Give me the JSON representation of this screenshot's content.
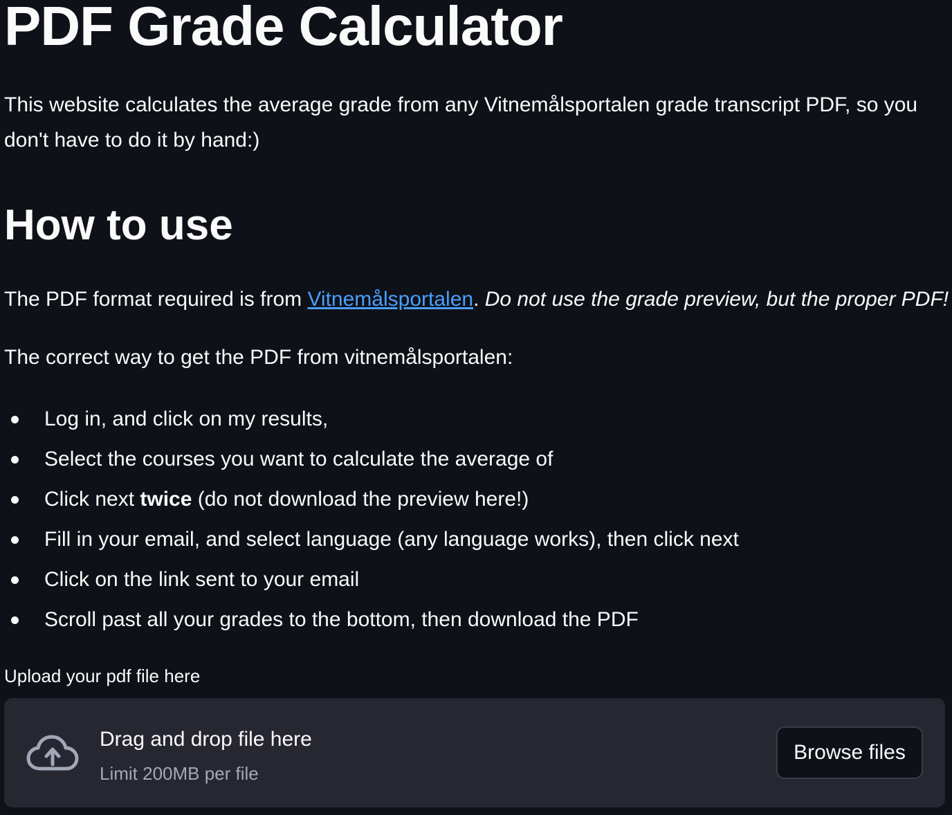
{
  "page": {
    "title": "PDF Grade Calculator",
    "intro": "This website calculates the average grade from any Vitnemålsportalen grade transcript PDF, so you don't have to do it by hand:)"
  },
  "how_to": {
    "heading": "How to use",
    "format_prefix": "The PDF format required is from ",
    "format_link": "Vitnemålsportalen",
    "format_period": ". ",
    "format_warning": "Do not use the grade preview, but the proper PDF!",
    "correct_way": "The correct way to get the PDF from vitnemålsportalen:",
    "steps": [
      {
        "text": "Log in, and click on my results,"
      },
      {
        "text": "Select the courses you want to calculate the average of"
      },
      {
        "prefix": "Click next ",
        "bold": "twice",
        "suffix": " (do not download the preview here!)"
      },
      {
        "text": "Fill in your email, and select language (any language works), then click next"
      },
      {
        "text": "Click on the link sent to your email"
      },
      {
        "text": "Scroll past all your grades to the bottom, then download the PDF"
      }
    ]
  },
  "uploader": {
    "label": "Upload your pdf file here",
    "icon": "cloud-upload-icon",
    "drop_text": "Drag and drop file here",
    "limit_text": "Limit 200MB per file",
    "browse_label": "Browse files"
  },
  "colors": {
    "background": "#0e1117",
    "text": "#fafafa",
    "link": "#4a9eff",
    "dropzone_bg": "#262730",
    "muted_text": "#a3a8b8"
  }
}
